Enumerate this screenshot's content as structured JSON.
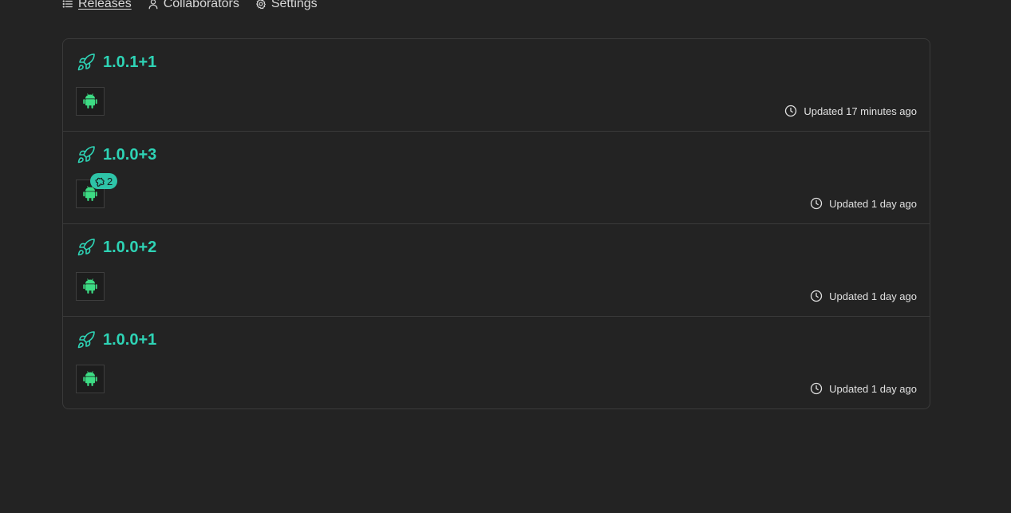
{
  "tabs": [
    {
      "label": "Releases",
      "active": true,
      "icon": "list-icon"
    },
    {
      "label": "Collaborators",
      "active": false,
      "icon": "user-icon"
    },
    {
      "label": "Settings",
      "active": false,
      "icon": "gear-icon"
    }
  ],
  "colors": {
    "accent": "#2ed3b5",
    "android": "#3ddc84",
    "background": "#232323",
    "border": "#3a3a3a"
  },
  "releases": [
    {
      "name": "1.0.1+1",
      "platform": "android-icon",
      "badge": null,
      "updated": "Updated 17 minutes ago"
    },
    {
      "name": "1.0.0+3",
      "platform": "android-icon",
      "badge": "2",
      "badge_icon": "puzzle-icon",
      "updated": "Updated 1 day ago"
    },
    {
      "name": "1.0.0+2",
      "platform": "android-icon",
      "badge": null,
      "updated": "Updated 1 day ago"
    },
    {
      "name": "1.0.0+1",
      "platform": "android-icon",
      "badge": null,
      "updated": "Updated 1 day ago"
    }
  ]
}
